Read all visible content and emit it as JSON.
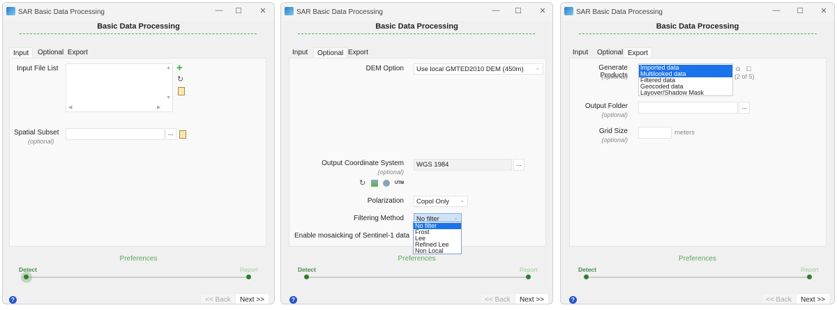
{
  "window": {
    "title": "SAR Basic Data Processing",
    "heading": "Basic Data Processing",
    "minimize": "—",
    "maximize": "☐",
    "close": "✕"
  },
  "tabs": [
    "Input",
    "Optional",
    "Export"
  ],
  "footer": {
    "preferences": "Preferences",
    "step_start": "Detect",
    "step_end": "Report",
    "back": "<< Back",
    "next": "Next >>",
    "help": "?"
  },
  "input_tab": {
    "file_list_label": "Input File List",
    "spatial_subset_label": "Spatial Subset",
    "optional": "(optional)",
    "browse": "..."
  },
  "optional_tab": {
    "dem_label": "DEM Option",
    "dem_value": "Use local GMTED2010 DEM (450m)",
    "ocs_label": "Output Coordinate System",
    "ocs_value": "WGS 1984",
    "utm": "UTM",
    "polarization_label": "Polarization",
    "polarization_value": "Copol Only",
    "filter_label": "Filtering Method",
    "filter_value": "No filter",
    "filter_options": [
      "No filter",
      "Frost",
      "Lee",
      "Refined Lee",
      "Non Local"
    ],
    "mosaic_label": "Enable mosaicking of Sentinel-1 data"
  },
  "export_tab": {
    "products_label": "Generate Products",
    "products": [
      "Imported data",
      "Multilooked data",
      "Filtered data",
      "Geocoded data",
      "Layover/Shadow Mask"
    ],
    "selected_count": "(2 of 5)",
    "output_folder_label": "Output Folder",
    "grid_size_label": "Grid Size",
    "grid_unit": "meters"
  },
  "colors": {
    "accent": "#4caf50",
    "selection": "#1a73e8"
  }
}
